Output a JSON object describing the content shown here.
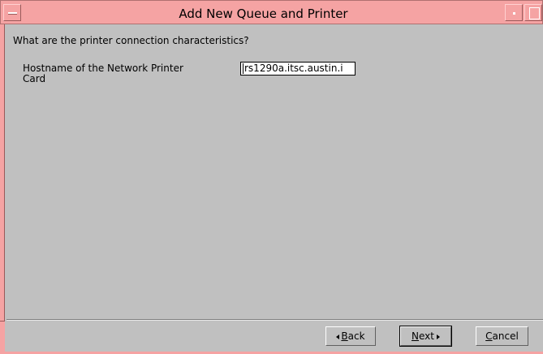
{
  "window": {
    "title": "Add New Queue and Printer",
    "titlebar_color": "#f5a3a3",
    "background_color": "#c0c0c0"
  },
  "form": {
    "question": "What are the printer connection characteristics?",
    "hostname_label_line1": "Hostname of the Network Printer",
    "hostname_label_line2": "Card",
    "hostname_value": "rs1290a.itsc.austin.i"
  },
  "buttons": {
    "back_mnemonic": "B",
    "back_rest": "ack",
    "next_mnemonic": "N",
    "next_rest": "ext",
    "cancel_mnemonic": "C",
    "cancel_rest": "ancel"
  },
  "icons": {
    "window_menu": "window-menu-icon",
    "minimize": "minimize-icon",
    "maximize": "maximize-icon",
    "back_arrow": "arrow-left-icon",
    "next_arrow": "arrow-right-icon"
  }
}
